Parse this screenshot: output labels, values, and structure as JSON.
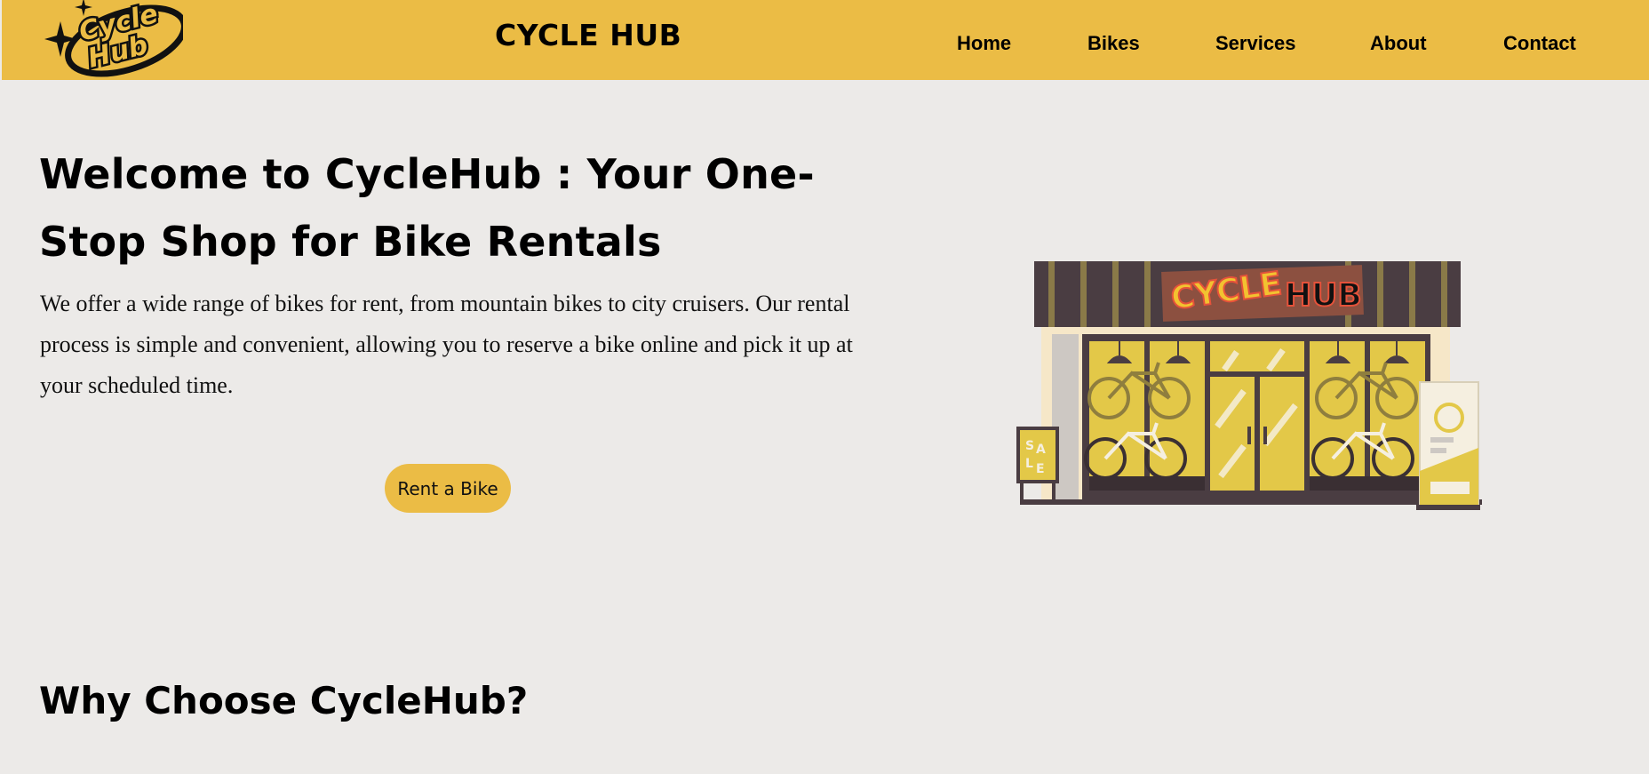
{
  "header": {
    "logo_text": [
      "Cycle",
      "Hub"
    ],
    "brand_title": "CYCLE HUB",
    "nav": [
      {
        "label": "Home"
      },
      {
        "label": "Bikes"
      },
      {
        "label": "Services"
      },
      {
        "label": "About"
      },
      {
        "label": "Contact"
      }
    ]
  },
  "hero": {
    "title": "Welcome to CycleHub : Your One-Stop Shop for Bike Rentals",
    "description": "We offer a wide range of bikes for rent, from mountain bikes to city cruisers. Our rental process is simple and convenient, allowing you to reserve a bike online and pick it up at your scheduled time.",
    "cta_label": "Rent a Bike",
    "illustration": {
      "sign_words": [
        "CYCLE",
        "HUB"
      ],
      "sale_letters": [
        "S",
        "A",
        "L",
        "E"
      ]
    }
  },
  "section": {
    "why_title": "Why Choose CycleHub?"
  },
  "colors": {
    "accent": "#EBBC45",
    "background": "#ECEAE8",
    "text": "#111111"
  }
}
